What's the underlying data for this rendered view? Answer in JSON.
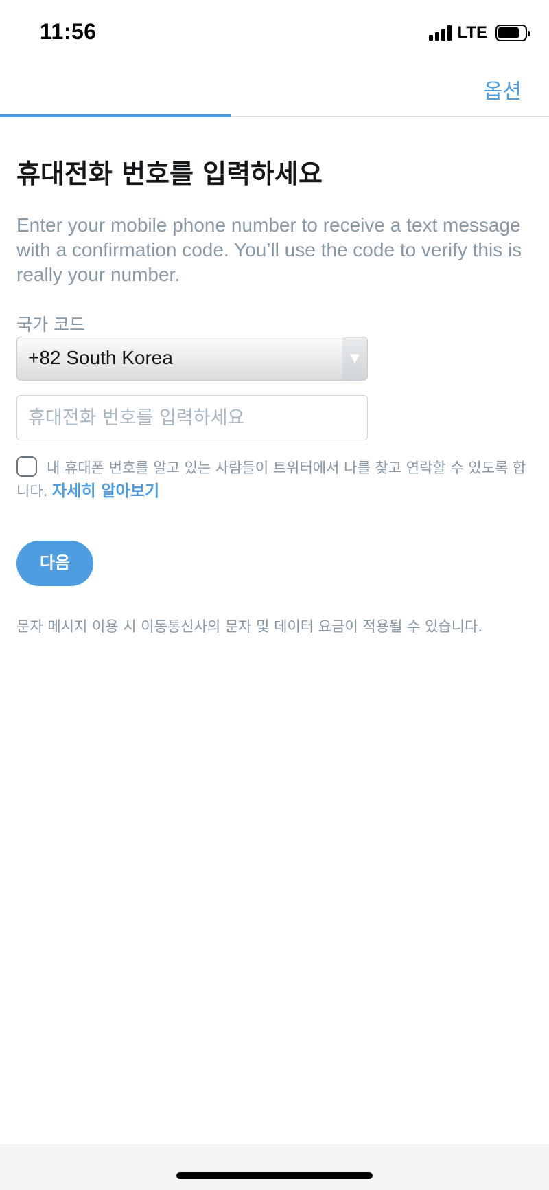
{
  "status_bar": {
    "time": "11:56",
    "network": "LTE",
    "signal_bars": 4,
    "battery_icon": "battery-icon"
  },
  "nav": {
    "options_label": "옵션",
    "progress_fraction": 0.42
  },
  "main": {
    "title": "휴대전화 번호를 입력하세요",
    "description": "Enter your mobile phone number to receive a text message with a confirmation code. You’ll use the code to verify this is really your number.",
    "country_code_label": "국가 코드",
    "country_code_value": "+82 South Korea",
    "phone_placeholder": "휴대전화 번호를 입력하세요",
    "phone_value": "",
    "discoverability_text": "내 휴대폰 번호를 알고 있는 사람들이 트위터에서 나를 찾고 연락할 수 있도록 합니다.",
    "learn_more_label": "자세히 알아보기",
    "checkbox_checked": false,
    "next_button_label": "다음",
    "footnote": "문자 메시지 이용 시 이동통신사의 문자 및 데이터 요금이 적용될 수 있습니다."
  },
  "colors": {
    "accent": "#4d9de0",
    "muted_text": "#8899a6",
    "title_text": "#14171a"
  }
}
